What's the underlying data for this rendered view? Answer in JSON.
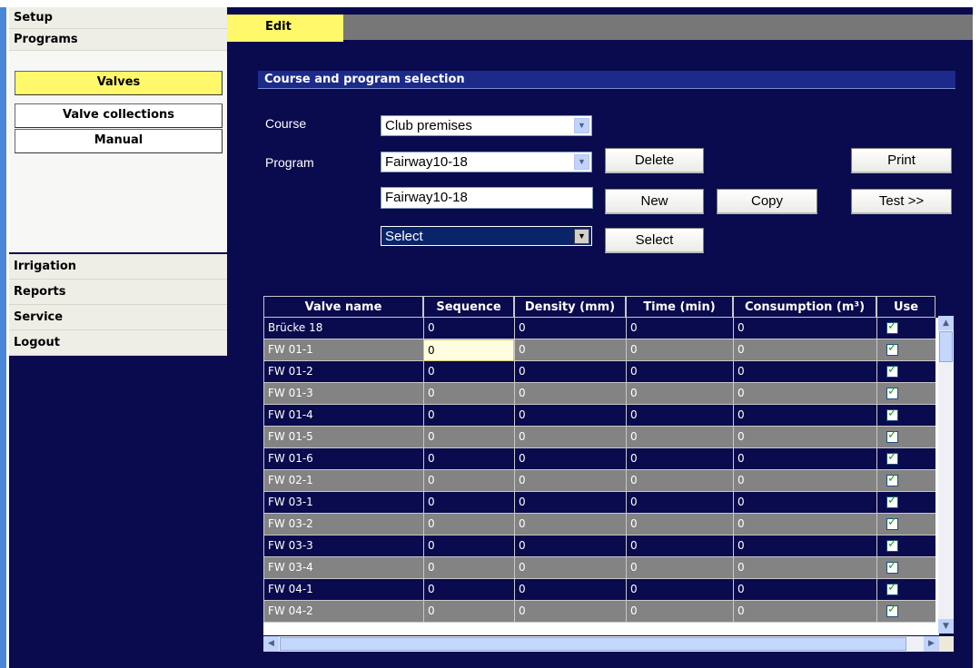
{
  "sidebar": {
    "setup": "Setup",
    "programs": "Programs",
    "valves": "Valves",
    "valve_collections": "Valve collections",
    "manual": "Manual",
    "irrigation": "Irrigation",
    "reports": "Reports",
    "service": "Service",
    "logout": "Logout"
  },
  "tabs": {
    "edit": "Edit"
  },
  "section": {
    "title": "Course and program selection"
  },
  "form": {
    "course_label": "Course",
    "course_value": "Club premises",
    "program_label": "Program",
    "program_value": "Fairway10-18",
    "program_name_value": "Fairway10-18",
    "select_value": "Select",
    "buttons": {
      "delete": "Delete",
      "print": "Print",
      "new": "New",
      "copy": "Copy",
      "test": "Test >>",
      "select": "Select"
    }
  },
  "grid": {
    "columns": [
      "Valve name",
      "Sequence",
      "Density (mm)",
      "Time (min)",
      "Consumption (m³)",
      "Use"
    ],
    "rows": [
      {
        "name": "Brücke 18",
        "sequence": "0",
        "density": "0",
        "time": "0",
        "consumption": "0",
        "use": true
      },
      {
        "name": "FW 01-1",
        "sequence": "0",
        "density": "0",
        "time": "0",
        "consumption": "0",
        "use": true
      },
      {
        "name": "FW 01-2",
        "sequence": "0",
        "density": "0",
        "time": "0",
        "consumption": "0",
        "use": true
      },
      {
        "name": "FW 01-3",
        "sequence": "0",
        "density": "0",
        "time": "0",
        "consumption": "0",
        "use": true
      },
      {
        "name": "FW 01-4",
        "sequence": "0",
        "density": "0",
        "time": "0",
        "consumption": "0",
        "use": true
      },
      {
        "name": "FW 01-5",
        "sequence": "0",
        "density": "0",
        "time": "0",
        "consumption": "0",
        "use": true
      },
      {
        "name": "FW 01-6",
        "sequence": "0",
        "density": "0",
        "time": "0",
        "consumption": "0",
        "use": true
      },
      {
        "name": "FW 02-1",
        "sequence": "0",
        "density": "0",
        "time": "0",
        "consumption": "0",
        "use": true
      },
      {
        "name": "FW 03-1",
        "sequence": "0",
        "density": "0",
        "time": "0",
        "consumption": "0",
        "use": true
      },
      {
        "name": "FW 03-2",
        "sequence": "0",
        "density": "0",
        "time": "0",
        "consumption": "0",
        "use": true
      },
      {
        "name": "FW 03-3",
        "sequence": "0",
        "density": "0",
        "time": "0",
        "consumption": "0",
        "use": true
      },
      {
        "name": "FW 03-4",
        "sequence": "0",
        "density": "0",
        "time": "0",
        "consumption": "0",
        "use": true
      },
      {
        "name": "FW 04-1",
        "sequence": "0",
        "density": "0",
        "time": "0",
        "consumption": "0",
        "use": true
      },
      {
        "name": "FW 04-2",
        "sequence": "0",
        "density": "0",
        "time": "0",
        "consumption": "0",
        "use": true
      }
    ]
  },
  "colors": {
    "background": "#0a0a4e",
    "active_yellow": "#fff86a",
    "row_alt_grey": "#838383",
    "section_blue": "#1c2a8a"
  }
}
